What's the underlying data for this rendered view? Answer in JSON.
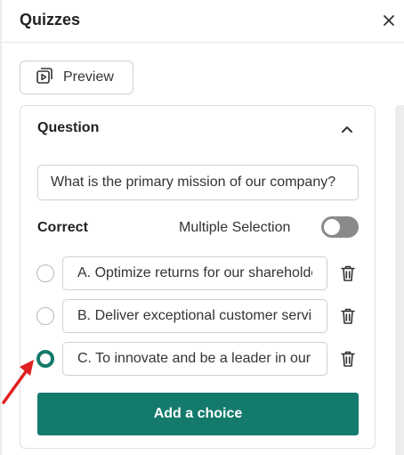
{
  "header": {
    "title": "Quizzes"
  },
  "toolbar": {
    "preview_label": "Preview"
  },
  "question_card": {
    "title": "Question",
    "question_value": "What is the primary mission of our company?",
    "correct_label": "Correct",
    "multiple_selection_label": "Multiple Selection",
    "multiple_selection_on": false,
    "choices": [
      {
        "value": "A. Optimize returns for our shareholders",
        "selected": false
      },
      {
        "value": "B. Deliver exceptional customer service",
        "selected": false
      },
      {
        "value": "C. To innovate and be a leader in our field",
        "selected": true
      }
    ],
    "add_choice_label": "Add a choice"
  },
  "colors": {
    "accent": "#137a6c",
    "annotation_arrow": "#e02020"
  },
  "icons": {
    "close": "close-icon",
    "preview": "preview-play-icon",
    "collapse": "chevron-up-icon",
    "delete": "trash-icon"
  }
}
